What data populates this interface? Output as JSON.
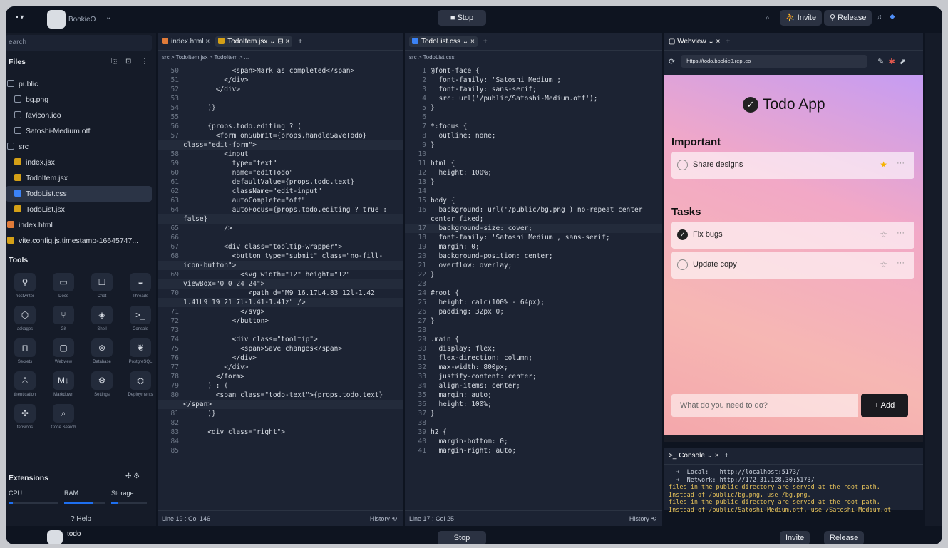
{
  "app": {
    "name": "BookieO",
    "stop": "Stop",
    "invite": "Invite",
    "release": "Release",
    "bottom_name": "todo",
    "bottom_stop": "Stop",
    "bottom_invite": "Invite",
    "bottom_release": "Release"
  },
  "sidebar": {
    "search_placeholder": "earch",
    "files_title": "Files",
    "files": [
      {
        "label": "public",
        "kind": "folder"
      },
      {
        "label": "bg.png",
        "kind": "image"
      },
      {
        "label": "favicon.ico",
        "kind": "image"
      },
      {
        "label": "Satoshi-Medium.otf",
        "kind": "file"
      },
      {
        "label": "src",
        "kind": "folder"
      },
      {
        "label": "index.jsx",
        "kind": "jsx"
      },
      {
        "label": "TodoItem.jsx",
        "kind": "jsx"
      },
      {
        "label": "TodoList.css",
        "kind": "css"
      },
      {
        "label": "TodoList.jsx",
        "kind": "jsx"
      },
      {
        "label": "index.html",
        "kind": "html"
      },
      {
        "label": "vite.config.js.timestamp-16645747...",
        "kind": "js"
      }
    ],
    "tools_title": "Tools",
    "tools": [
      {
        "label": "hostwriter",
        "icon": "ghostwriter-icon",
        "glyph": "⚲"
      },
      {
        "label": "Docs",
        "icon": "docs-icon",
        "glyph": "▭"
      },
      {
        "label": "Chat",
        "icon": "chat-icon",
        "glyph": "☐"
      },
      {
        "label": "Threads",
        "icon": "threads-icon",
        "glyph": "◒"
      },
      {
        "label": "ackages",
        "icon": "packages-icon",
        "glyph": "⬡"
      },
      {
        "label": "Git",
        "icon": "git-icon",
        "glyph": "⑂"
      },
      {
        "label": "Shell",
        "icon": "shell-icon",
        "glyph": "◈"
      },
      {
        "label": "Console",
        "icon": "console-icon",
        "glyph": ">_"
      },
      {
        "label": "Secrets",
        "icon": "lock-icon",
        "glyph": "⊓"
      },
      {
        "label": "Webview",
        "icon": "webview-icon",
        "glyph": "▢"
      },
      {
        "label": "Database",
        "icon": "database-icon",
        "glyph": "⊜"
      },
      {
        "label": "PostgreSQL",
        "icon": "postgresql-icon",
        "glyph": "❦"
      },
      {
        "label": "thentication",
        "icon": "user-icon",
        "glyph": "♙"
      },
      {
        "label": "Markdown",
        "icon": "markdown-icon",
        "glyph": "M↓"
      },
      {
        "label": "Settings",
        "icon": "gear-icon",
        "glyph": "⚙"
      },
      {
        "label": "Deployments",
        "icon": "deploy-icon",
        "glyph": "⛭"
      },
      {
        "label": "tensions",
        "icon": "extensions-icon",
        "glyph": "✣"
      },
      {
        "label": "Code Search",
        "icon": "search-icon",
        "glyph": "⌕"
      }
    ],
    "extensions_title": "Extensions",
    "cpu": "CPU",
    "ram": "RAM",
    "storage": "Storage",
    "help": "? Help"
  },
  "editor1": {
    "tabs": [
      "index.html",
      "TodoItem.jsx"
    ],
    "crumb": "src > TodoItem.jsx > TodoItem > ...",
    "status": "Line 19 : Col 146",
    "history": "History",
    "lines": [
      [
        "50",
        "            <span>Mark as completed</span>"
      ],
      [
        "51",
        "          </div>"
      ],
      [
        "52",
        "        </div>"
      ],
      [
        "53",
        ""
      ],
      [
        "54",
        "      )}"
      ],
      [
        "55",
        ""
      ],
      [
        "56",
        "      {props.todo.editing ? ("
      ],
      [
        "57",
        "        <form onSubmit={props.handleSaveTodo}"
      ],
      [
        "",
        "class=\"edit-form\">"
      ],
      [
        "58",
        "          <input"
      ],
      [
        "59",
        "            type=\"text\""
      ],
      [
        "60",
        "            name=\"editTodo\""
      ],
      [
        "61",
        "            defaultValue={props.todo.text}"
      ],
      [
        "62",
        "            className=\"edit-input\""
      ],
      [
        "63",
        "            autoComplete=\"off\""
      ],
      [
        "64",
        "            autoFocus={props.todo.editing ? true :"
      ],
      [
        "",
        "false}"
      ],
      [
        "65",
        "          />"
      ],
      [
        "66",
        ""
      ],
      [
        "67",
        "          <div class=\"tooltip-wrapper\">"
      ],
      [
        "68",
        "            <button type=\"submit\" class=\"no-fill-"
      ],
      [
        "",
        "icon-button\">"
      ],
      [
        "69",
        "              <svg width=\"12\" height=\"12\""
      ],
      [
        "",
        "viewBox=\"0 0 24 24\">"
      ],
      [
        "70",
        "                <path d=\"M9 16.17L4.83 12l-1.42"
      ],
      [
        "",
        "1.41L9 19 21 7l-1.41-1.41z\" />"
      ],
      [
        "71",
        "              </svg>"
      ],
      [
        "72",
        "            </button>"
      ],
      [
        "73",
        ""
      ],
      [
        "74",
        "            <div class=\"tooltip\">"
      ],
      [
        "75",
        "              <span>Save changes</span>"
      ],
      [
        "76",
        "            </div>"
      ],
      [
        "77",
        "          </div>"
      ],
      [
        "78",
        "        </form>"
      ],
      [
        "79",
        "      ) : ("
      ],
      [
        "80",
        "        <span class=\"todo-text\">{props.todo.text}"
      ],
      [
        "",
        "</span>"
      ],
      [
        "81",
        "      )}"
      ],
      [
        "82",
        ""
      ],
      [
        "83",
        "      <div class=\"right\">"
      ],
      [
        "84",
        ""
      ],
      [
        "85",
        ""
      ]
    ]
  },
  "editor2": {
    "tabs": [
      "TodoList.css"
    ],
    "crumb": "src > TodoList.css",
    "status": "Line 17 : Col 25",
    "history": "History",
    "lines": [
      [
        "1",
        "@font-face {"
      ],
      [
        "2",
        "  font-family: 'Satoshi Medium';"
      ],
      [
        "3",
        "  font-family: sans-serif;"
      ],
      [
        "4",
        "  src: url('/public/Satoshi-Medium.otf');"
      ],
      [
        "5",
        "}"
      ],
      [
        "6",
        ""
      ],
      [
        "7",
        "*:focus {"
      ],
      [
        "8",
        "  outline: none;"
      ],
      [
        "9",
        "}"
      ],
      [
        "10",
        ""
      ],
      [
        "11",
        "html {"
      ],
      [
        "12",
        "  height: 100%;"
      ],
      [
        "13",
        "}"
      ],
      [
        "14",
        ""
      ],
      [
        "15",
        "body {"
      ],
      [
        "16",
        "  background: url('/public/bg.png') no-repeat center"
      ],
      [
        "",
        "center fixed;"
      ],
      [
        "17",
        "  background-size: cover;"
      ],
      [
        "18",
        "  font-family: 'Satoshi Medium', sans-serif;"
      ],
      [
        "19",
        "  margin: 0;"
      ],
      [
        "20",
        "  background-position: center;"
      ],
      [
        "21",
        "  overflow: overlay;"
      ],
      [
        "22",
        "}"
      ],
      [
        "23",
        ""
      ],
      [
        "24",
        "#root {"
      ],
      [
        "25",
        "  height: calc(100% - 64px);"
      ],
      [
        "26",
        "  padding: 32px 0;"
      ],
      [
        "27",
        "}"
      ],
      [
        "28",
        ""
      ],
      [
        "29",
        ".main {"
      ],
      [
        "30",
        "  display: flex;"
      ],
      [
        "31",
        "  flex-direction: column;"
      ],
      [
        "32",
        "  max-width: 800px;"
      ],
      [
        "33",
        "  justify-content: center;"
      ],
      [
        "34",
        "  align-items: center;"
      ],
      [
        "35",
        "  margin: auto;"
      ],
      [
        "36",
        "  height: 100%;"
      ],
      [
        "37",
        "}"
      ],
      [
        "38",
        ""
      ],
      [
        "39",
        "h2 {"
      ],
      [
        "40",
        "  margin-bottom: 0;"
      ],
      [
        "41",
        "  margin-right: auto;"
      ]
    ]
  },
  "webview": {
    "tab": "Webview",
    "url": "https://todo.bookie0.repl.co",
    "title": "Todo App",
    "important_heading": "Important",
    "tasks_heading": "Tasks",
    "input_placeholder": "What do you need to do?",
    "add_label": "+ Add",
    "important": [
      {
        "text": "Share designs",
        "done": false,
        "starred": true
      }
    ],
    "tasks": [
      {
        "text": "Fix bugs",
        "done": true,
        "starred": false
      },
      {
        "text": "Update copy",
        "done": false,
        "starred": false
      }
    ]
  },
  "console": {
    "tab": "Console",
    "lines": [
      "  ➜  Local:   http://localhost:5173/",
      "  ➜  Network: http://172.31.128.30:5173/",
      "files in the public directory are served at the root path.",
      "Instead of /public/bg.png, use /bg.png.",
      "files in the public directory are served at the root path.",
      "Instead of /public/Satoshi-Medium.otf, use /Satoshi-Medium.ot"
    ]
  },
  "colors": {
    "accent": "#1e6ff0",
    "jsx": "#d4a017",
    "css": "#3b82f6",
    "star": "#f5b301"
  }
}
